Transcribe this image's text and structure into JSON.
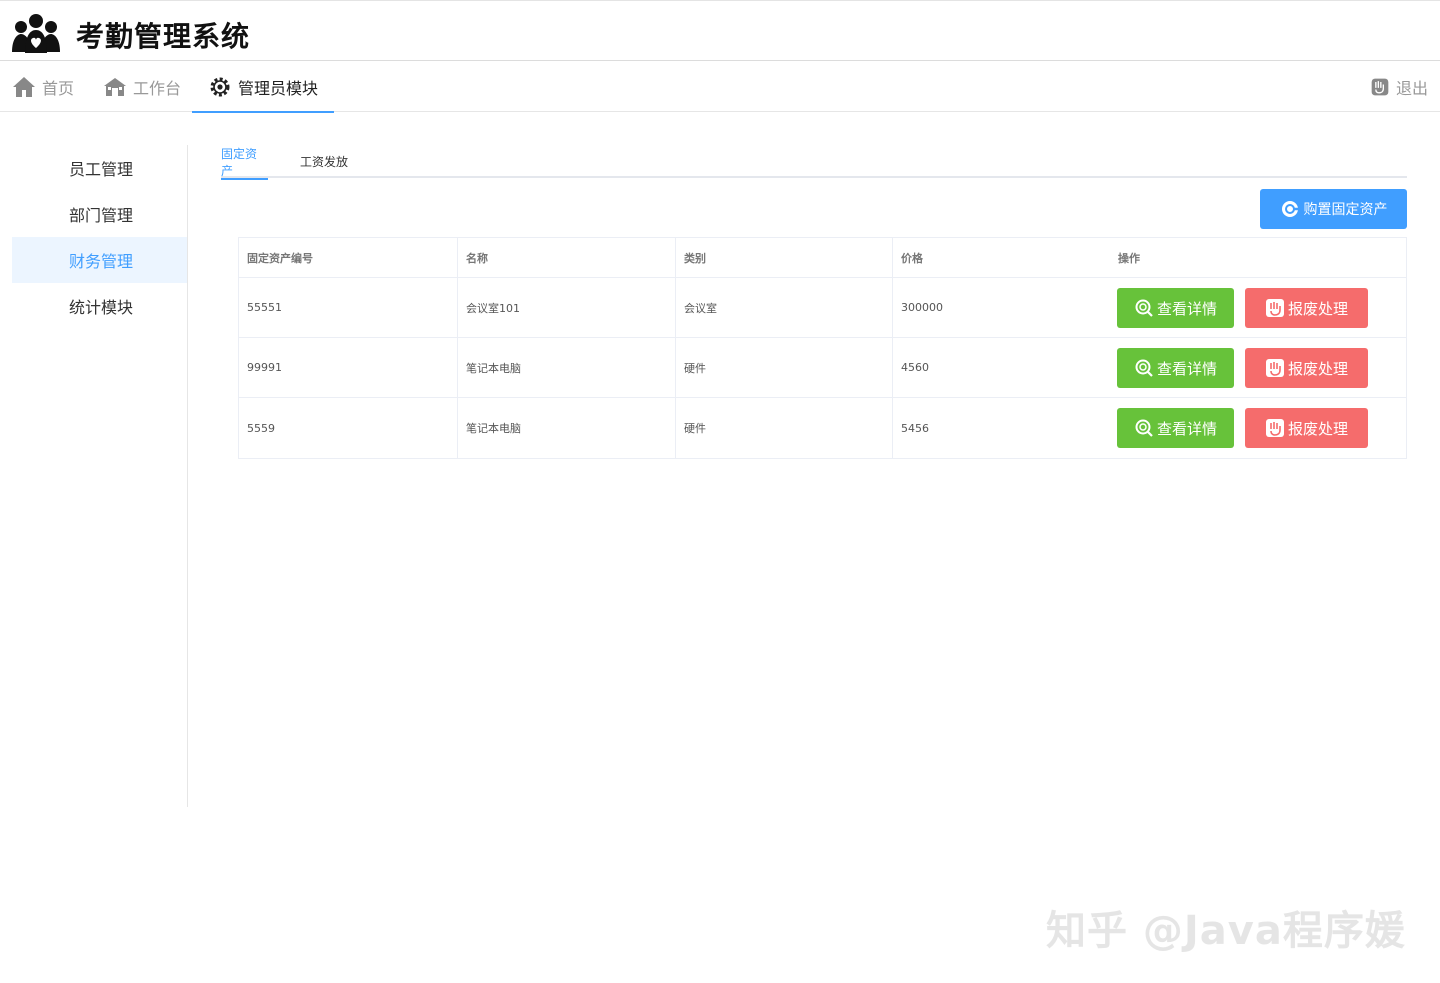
{
  "app": {
    "title": "考勤管理系统",
    "logo_icon": "people-group-icon"
  },
  "nav": {
    "items": [
      {
        "label": "首页",
        "icon": "home-icon"
      },
      {
        "label": "工作台",
        "icon": "workbench-icon"
      },
      {
        "label": "管理员模块",
        "icon": "gear-icon",
        "active": true
      }
    ],
    "logout": {
      "label": "退出",
      "icon": "logout-icon"
    }
  },
  "sidebar": {
    "items": [
      {
        "label": "员工管理"
      },
      {
        "label": "部门管理"
      },
      {
        "label": "财务管理",
        "active": true
      },
      {
        "label": "统计模块"
      }
    ]
  },
  "tabs": [
    {
      "label": "固定资产",
      "active": true
    },
    {
      "label": "工资发放"
    }
  ],
  "actions": {
    "purchase_label": "购置固定资产",
    "purchase_icon": "plus-circle-icon"
  },
  "table": {
    "columns": [
      "固定资产编号",
      "名称",
      "类别",
      "价格",
      "操作"
    ],
    "rows": [
      {
        "id": "55551",
        "name": "会议室101",
        "category": "会议室",
        "price": "300000",
        "view_label": "查看详情",
        "scrap_label": "报废处理"
      },
      {
        "id": "99991",
        "name": "笔记本电脑",
        "category": "硬件",
        "price": "4560",
        "view_label": "查看详情",
        "scrap_label": "报废处理"
      },
      {
        "id": "5559",
        "name": "笔记本电脑",
        "category": "硬件",
        "price": "5456",
        "view_label": "查看详情",
        "scrap_label": "报废处理"
      }
    ]
  },
  "watermark": "知乎 @Java程序媛",
  "colors": {
    "primary": "#409eff",
    "success": "#67c23a",
    "danger": "#f56c6c",
    "sidebar_active_bg": "#ecf5ff"
  }
}
